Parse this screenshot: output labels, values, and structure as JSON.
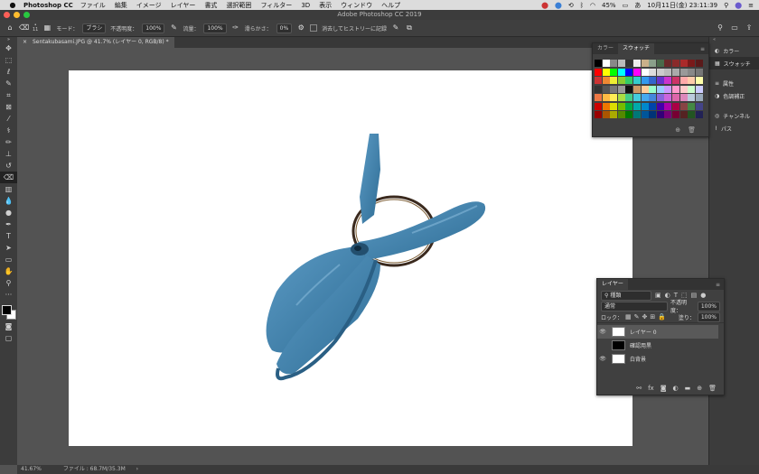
{
  "menubar": {
    "app_name": "Photoshop CC",
    "items": [
      "ファイル",
      "編集",
      "イメージ",
      "レイヤー",
      "書式",
      "選択範囲",
      "フィルター",
      "3D",
      "表示",
      "ウィンドウ",
      "ヘルプ"
    ],
    "battery": "45%",
    "clock": "10月11日(金)  23:11:39"
  },
  "window": {
    "title": "Adobe Photoshop CC 2019"
  },
  "options": {
    "brush_size": "11",
    "mode_label": "モード：",
    "mode_value": "ブラシ",
    "opacity_label": "不透明度：",
    "opacity_value": "100%",
    "flow_label": "流量：",
    "flow_value": "100%",
    "smoothing_label": "滑らかさ：",
    "smoothing_value": "0%",
    "history_label": "消去してヒストリーに記録"
  },
  "document": {
    "tab_title": "Sentakubasami.JPG @ 41.7% (レイヤー 0, RGB/8) *"
  },
  "status": {
    "zoom": "41.67%",
    "file_info": "ファイル : 68.7M/35.3M"
  },
  "swatch_panel": {
    "tabs": [
      "カラー",
      "スウォッチ"
    ],
    "active_tab": "スウォッチ"
  },
  "dock": {
    "items": [
      {
        "label": "カラー",
        "icon": "color-wheel-icon"
      },
      {
        "label": "スウォッチ",
        "icon": "swatches-grid-icon"
      },
      {
        "label": "属性",
        "icon": "properties-icon"
      },
      {
        "label": "色調補正",
        "icon": "adjustments-icon"
      },
      {
        "label": "チャンネル",
        "icon": "channels-icon"
      },
      {
        "label": "パス",
        "icon": "paths-icon"
      }
    ]
  },
  "layers_panel": {
    "title": "レイヤー",
    "filter_kind": "種類",
    "blend_mode": "通常",
    "opacity_label": "不透明度：",
    "opacity_value": "100%",
    "lock_label": "ロック：",
    "fill_label": "塗り：",
    "fill_value": "100%",
    "layers": [
      {
        "name": "レイヤー 0",
        "visible": true,
        "selected": true
      },
      {
        "name": "確認用黒",
        "visible": false,
        "selected": false
      },
      {
        "name": "白背景",
        "visible": true,
        "selected": false
      }
    ]
  },
  "colors": {
    "accent_blue": "#3a8fd5",
    "clip_blue": "#3e7fa8",
    "foreground": "#000000",
    "background": "#ffffff"
  }
}
